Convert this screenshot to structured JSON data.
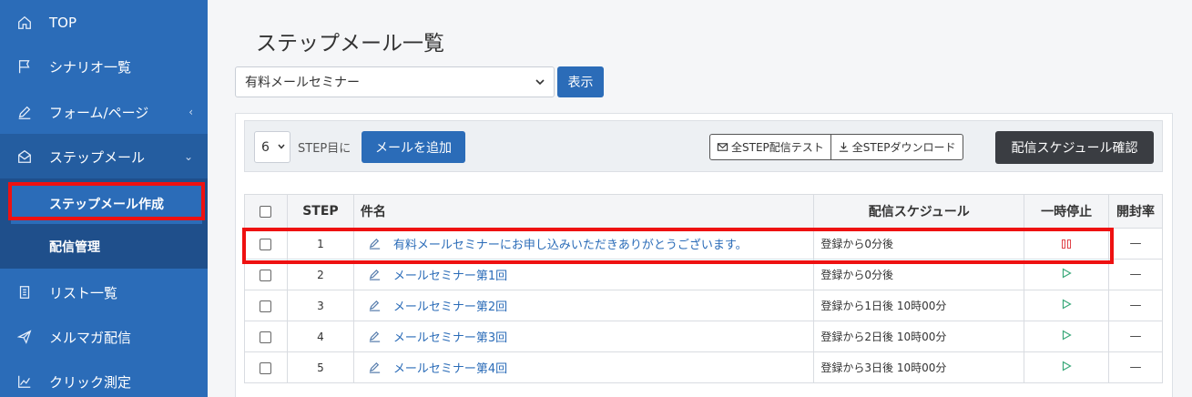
{
  "sidebar": {
    "items": [
      {
        "label": "TOP",
        "icon": "home-icon"
      },
      {
        "label": "シナリオ一覧",
        "icon": "flag-icon"
      },
      {
        "label": "フォーム/ページ",
        "icon": "pen-icon",
        "chevron": "‹"
      },
      {
        "label": "ステップメール",
        "icon": "envelope-open-icon",
        "chevron": "⌄"
      },
      {
        "label": "リスト一覧",
        "icon": "list-icon"
      },
      {
        "label": "メルマガ配信",
        "icon": "send-icon"
      },
      {
        "label": "クリック測定",
        "icon": "chart-icon"
      }
    ],
    "subitems": [
      {
        "label": "ステップメール作成"
      },
      {
        "label": "配信管理"
      }
    ]
  },
  "page": {
    "title": "ステップメール一覧"
  },
  "scenario_select": {
    "value": "有料メールセミナー"
  },
  "show_button": "表示",
  "toolbar": {
    "step_value": "6",
    "step_label": "STEP目に",
    "add_button": "メールを追加",
    "test_button": "全STEP配信テスト",
    "download_button": "全STEPダウンロード",
    "schedule_button": "配信スケジュール確認"
  },
  "table": {
    "headers": {
      "step": "STEP",
      "name": "件名",
      "schedule": "配信スケジュール",
      "pause": "一時停止",
      "open": "開封率"
    },
    "rows": [
      {
        "step": "1",
        "name": "有料メールセミナーにお申し込みいただきありがとうございます。",
        "schedule": "登録から0分後",
        "status": "paused",
        "open": "—"
      },
      {
        "step": "2",
        "name": "メールセミナー第1回",
        "schedule": "登録から0分後",
        "status": "playing",
        "open": "—"
      },
      {
        "step": "3",
        "name": "メールセミナー第2回",
        "schedule": "登録から1日後 10時00分",
        "status": "playing",
        "open": "—"
      },
      {
        "step": "4",
        "name": "メールセミナー第3回",
        "schedule": "登録から2日後 10時00分",
        "status": "playing",
        "open": "—"
      },
      {
        "step": "5",
        "name": "メールセミナー第4回",
        "schedule": "登録から3日後 10時00分",
        "status": "playing",
        "open": "—"
      }
    ]
  },
  "colors": {
    "sidebar": "#2b6cb8",
    "primary": "#2b6cb8",
    "highlight": "#ee1111",
    "dark_button": "#3a3d42"
  }
}
